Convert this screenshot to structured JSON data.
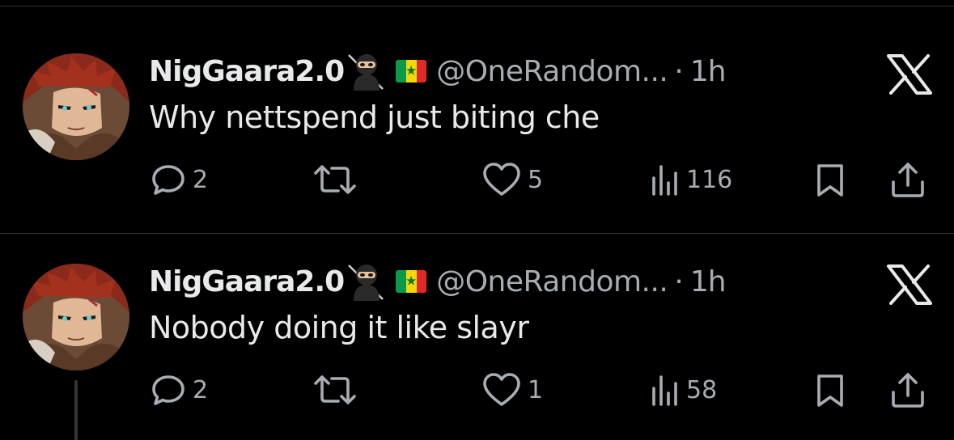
{
  "tweets": [
    {
      "display_name": "NigGaara2.0",
      "handle": "@OneRandom...",
      "separator": "·",
      "time": "1h",
      "text": "Why nettspend just biting che",
      "replies": "2",
      "retweets": "",
      "likes": "5",
      "views": "116",
      "icons": [
        "ninja-emoji",
        "senegal-flag-emoji",
        "x-logo",
        "reply-icon",
        "retweet-icon",
        "like-icon",
        "views-icon",
        "bookmark-icon",
        "share-icon"
      ]
    },
    {
      "display_name": "NigGaara2.0",
      "handle": "@OneRandom...",
      "separator": "·",
      "time": "1h",
      "text": "Nobody doing it like slayr",
      "replies": "2",
      "retweets": "",
      "likes": "1",
      "views": "58",
      "icons": [
        "ninja-emoji",
        "senegal-flag-emoji",
        "x-logo",
        "reply-icon",
        "retweet-icon",
        "like-icon",
        "views-icon",
        "bookmark-icon",
        "share-icon"
      ]
    }
  ],
  "colors": {
    "background": "#000000",
    "primary_text": "#e7e9ea",
    "secondary_text": "#a7adb2",
    "divider": "#2f3336"
  }
}
